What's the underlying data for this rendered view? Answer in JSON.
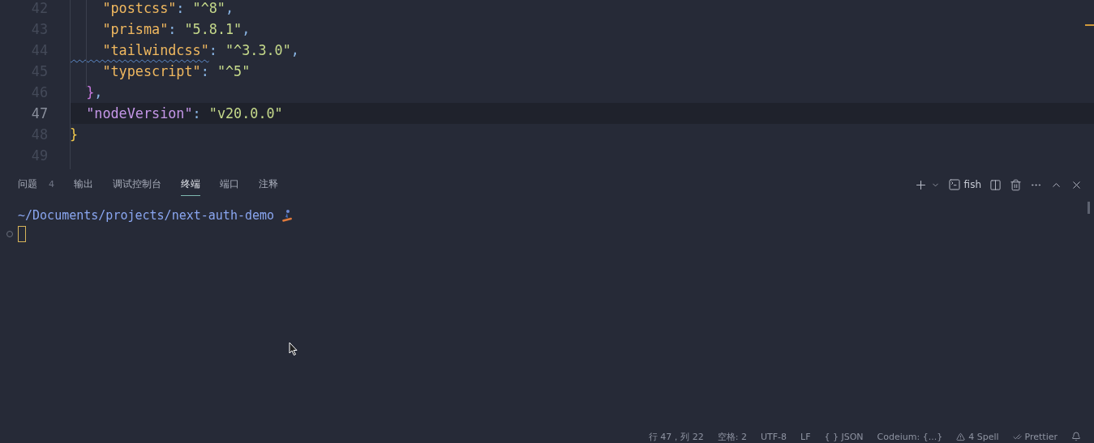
{
  "editor": {
    "lines": [
      {
        "number": "42",
        "current": false,
        "tokens": [
          {
            "kind": "key",
            "text": "    \"postcss\""
          },
          {
            "kind": "punct",
            "text": ": "
          },
          {
            "kind": "string",
            "text": "\"^8\""
          },
          {
            "kind": "punct",
            "text": ","
          }
        ]
      },
      {
        "number": "43",
        "current": false,
        "tokens": [
          {
            "kind": "key",
            "text": "    \"prisma\""
          },
          {
            "kind": "punct",
            "text": ": "
          },
          {
            "kind": "string",
            "text": "\"5.8.1\""
          },
          {
            "kind": "punct",
            "text": ","
          }
        ]
      },
      {
        "number": "44",
        "current": false,
        "tokens": [
          {
            "kind": "key",
            "text": "    \"tailwindcss\"",
            "squiggle": true
          },
          {
            "kind": "punct",
            "text": ": "
          },
          {
            "kind": "string",
            "text": "\"^3.3.0\""
          },
          {
            "kind": "punct",
            "text": ","
          }
        ]
      },
      {
        "number": "45",
        "current": false,
        "tokens": [
          {
            "kind": "key",
            "text": "    \"typescript\""
          },
          {
            "kind": "punct",
            "text": ": "
          },
          {
            "kind": "string",
            "text": "\"^5\""
          }
        ]
      },
      {
        "number": "46",
        "current": false,
        "tokens": [
          {
            "kind": "brace2",
            "text": "  }"
          },
          {
            "kind": "punct",
            "text": ","
          }
        ]
      },
      {
        "number": "47",
        "current": true,
        "tokens": [
          {
            "kind": "key2",
            "text": "  \"nodeVersion\""
          },
          {
            "kind": "punct",
            "text": ": "
          },
          {
            "kind": "string",
            "text": "\"v20.0.0\""
          }
        ]
      },
      {
        "number": "48",
        "current": false,
        "tokens": [
          {
            "kind": "brace",
            "text": "}"
          }
        ]
      },
      {
        "number": "49",
        "current": false
      }
    ]
  },
  "panel": {
    "tabs": [
      {
        "label": "问题",
        "badge": "4",
        "selected": false
      },
      {
        "label": "输出",
        "selected": false
      },
      {
        "label": "调试控制台",
        "selected": false
      },
      {
        "label": "终端",
        "selected": true
      },
      {
        "label": "端口",
        "selected": false
      },
      {
        "label": "注释",
        "selected": false
      }
    ],
    "shell": "fish"
  },
  "terminal": {
    "path": "~/Documents/projects/next-auth-demo"
  },
  "status_bar": [
    {
      "kind": "text",
      "text": "行 47，列 22"
    },
    {
      "kind": "text",
      "text": "空格: 2"
    },
    {
      "kind": "text",
      "text": "UTF-8"
    },
    {
      "kind": "text",
      "text": "LF"
    },
    {
      "kind": "text",
      "text": "{ } JSON"
    },
    {
      "kind": "text",
      "text": "Codeium: {...}"
    },
    {
      "kind": "warning",
      "text": "4 Spell"
    },
    {
      "kind": "check",
      "text": "Prettier"
    },
    {
      "kind": "bell"
    }
  ]
}
